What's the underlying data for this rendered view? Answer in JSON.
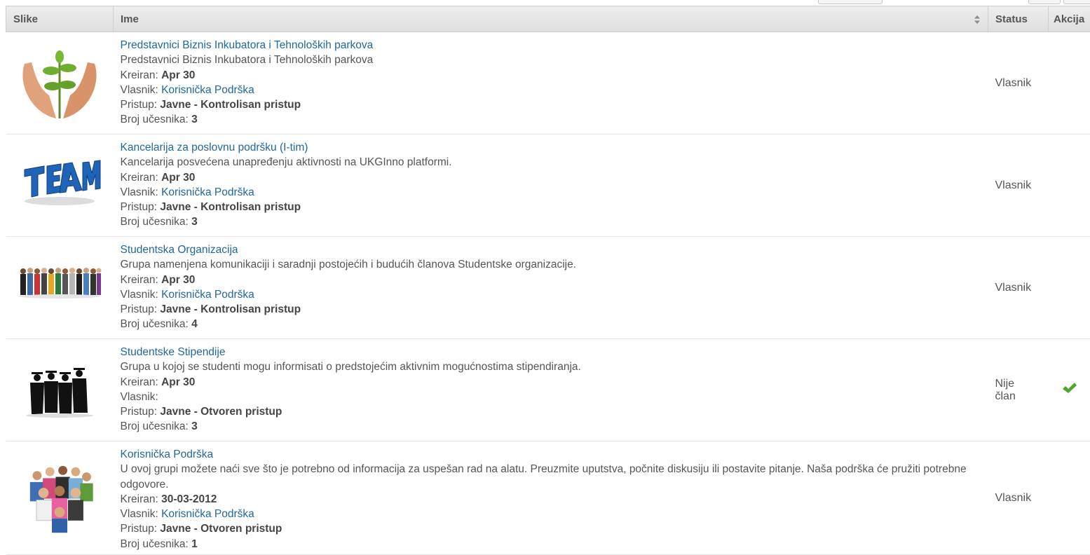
{
  "header": {
    "slike": "Slike",
    "ime": "Ime",
    "status": "Status",
    "akcija": "Akcija"
  },
  "labels": {
    "kreiran": "Kreiran:",
    "vlasnik": "Vlasnik:",
    "pristup": "Pristup:",
    "broj": "Broj učesnika:"
  },
  "rows": [
    {
      "title": "Predstavnici Biznis Inkubatora i Tehnoloških parkova",
      "description": "Predstavnici Biznis Inkubatora i Tehnoloških parkova",
      "kreiran": "Apr 30",
      "vlasnik": "Korisnička Podrška",
      "pristup": "Javne - Kontrolisan pristup",
      "broj": "3",
      "status": "Vlasnik",
      "image": "hands-plant-image"
    },
    {
      "title": "Kancelarija za poslovnu podršku (I-tim)",
      "description": "Kancelarija posvećena unapređenju aktivnosti na UKGInno platformi.",
      "kreiran": "Apr 30",
      "vlasnik": "Korisnička Podrška",
      "pristup": "Javne - Kontrolisan pristup",
      "broj": "3",
      "status": "Vlasnik",
      "image": "team-3d-text-image"
    },
    {
      "title": "Studentska Organizacija",
      "description": "Grupa namenjena komunikaciji i saradnji postojećih i budućih članova Studentske organizacije.",
      "kreiran": "Apr 30",
      "vlasnik": "Korisnička Podrška",
      "pristup": "Javne - Kontrolisan pristup",
      "broj": "4",
      "status": "Vlasnik",
      "image": "student-group-image"
    },
    {
      "title": "Studentske Stipendije",
      "description": "Grupa u kojoj se studenti mogu informisati o predstojećim aktivnim mogućnostima stipendiranja.",
      "kreiran": "Apr 30",
      "vlasnik": "",
      "pristup": "Javne - Otvoren pristup",
      "broj": "3",
      "status": "Nije član",
      "action": "✔",
      "image": "graduates-silhouette-image"
    },
    {
      "title": "Korisnička Podrška",
      "description": "U ovoj grupi možete naći sve što je potrebno od informacija za uspešan rad na alatu. Preuzmite uputstva, počnite diskusiju ili postavite pitanje. Naša podrška će pružiti potrebne odgovore.",
      "kreiran": "30-03-2012",
      "vlasnik": "Korisnička Podrška",
      "pristup": "Javne - Otvoren pristup",
      "broj": "1",
      "status": "Vlasnik",
      "image": "people-crowd-image"
    }
  ],
  "colors": {
    "link": "#21689c",
    "check": "#4fa532"
  }
}
